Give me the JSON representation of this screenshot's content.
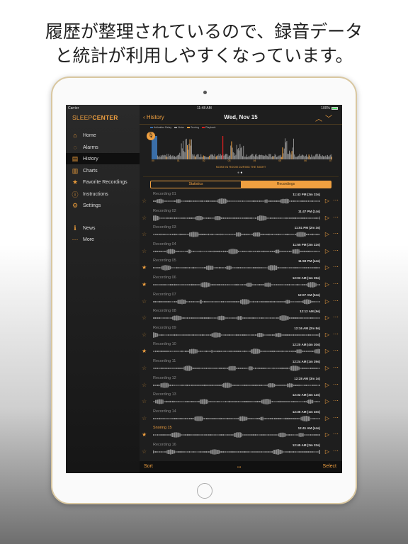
{
  "headline": {
    "line1": "履歴が整理されているので、録音データ",
    "line2": "と統計が利用しやすくなっています。"
  },
  "status": {
    "carrier": "Carrier",
    "time": "11:48 AM",
    "battery": "100%"
  },
  "sidebar": {
    "logo_a": "SLEEP",
    "logo_b": "CENTER",
    "items": [
      {
        "label": "Home",
        "icon": "house-icon",
        "glyph": "⌂"
      },
      {
        "label": "Alarms",
        "icon": "alarm-clock-icon",
        "glyph": "◌"
      },
      {
        "label": "History",
        "icon": "history-icon",
        "glyph": "▤",
        "selected": true
      },
      {
        "label": "Charts",
        "icon": "chart-icon",
        "glyph": "▥"
      },
      {
        "label": "Favorite Recordings",
        "icon": "star-icon",
        "glyph": "★"
      },
      {
        "label": "Instructions",
        "icon": "info-icon",
        "glyph": "ⓘ"
      },
      {
        "label": "Settings",
        "icon": "gear-icon",
        "glyph": "⚙"
      },
      {
        "label": "News",
        "icon": "news-icon",
        "glyph": "ℹ"
      },
      {
        "label": "More",
        "icon": "more-icon",
        "glyph": "⋯"
      }
    ]
  },
  "header": {
    "back": "History",
    "date": "Wed, Nov 15"
  },
  "chart": {
    "legend": [
      "Activation Delay",
      "Noise",
      "Snoring",
      "Playback"
    ],
    "legend_colors": [
      "#3a6ea8",
      "#9a9a9a",
      "#f0a040",
      "#e02020"
    ],
    "ticks": [
      "00",
      "01",
      "02",
      "03",
      "04",
      "05",
      "06",
      "07"
    ],
    "title": "NOISE IN ROOM DURING THE NIGHT"
  },
  "segments": {
    "statistics": "Statistics",
    "recordings": "Recordings",
    "active": "Recordings"
  },
  "recordings": [
    {
      "name": "Recording 01",
      "time": "11:43 PM (3m 33s)",
      "starred": false
    },
    {
      "name": "Recording 02",
      "time": "11:47 PM (14s)",
      "starred": false
    },
    {
      "name": "Recording 03",
      "time": "11:51 PM (2m 3s)",
      "starred": false
    },
    {
      "name": "Recording 04",
      "time": "11:55 PM (2m 22s)",
      "starred": false
    },
    {
      "name": "Recording 05",
      "time": "11:59 PM (44s)",
      "starred": true
    },
    {
      "name": "Recording 06",
      "time": "12:03 AM (1m 35s)",
      "starred": true
    },
    {
      "name": "Recording 07",
      "time": "12:07 AM (54s)",
      "starred": false
    },
    {
      "name": "Recording 08",
      "time": "12:12 AM (9s)",
      "starred": false
    },
    {
      "name": "Recording 09",
      "time": "12:16 AM (2m 8s)",
      "starred": false
    },
    {
      "name": "Recording 10",
      "time": "12:20 AM (4m 30s)",
      "starred": true
    },
    {
      "name": "Recording 11",
      "time": "12:24 AM (1m 39s)",
      "starred": false
    },
    {
      "name": "Recording 12",
      "time": "12:28 AM (3m 1s)",
      "starred": false
    },
    {
      "name": "Recording 13",
      "time": "12:32 AM (4m 12s)",
      "starred": false
    },
    {
      "name": "Recording 14",
      "time": "12:36 AM (1m 40s)",
      "starred": false
    },
    {
      "name": "Snoring 15",
      "time": "12:41 AM (44s)",
      "starred": true,
      "highlight": true
    },
    {
      "name": "Recording 16",
      "time": "12:45 AM (2m 32s)",
      "starred": false
    }
  ],
  "toolbar": {
    "sort": "Sort",
    "more": "•••",
    "select": "Select"
  }
}
